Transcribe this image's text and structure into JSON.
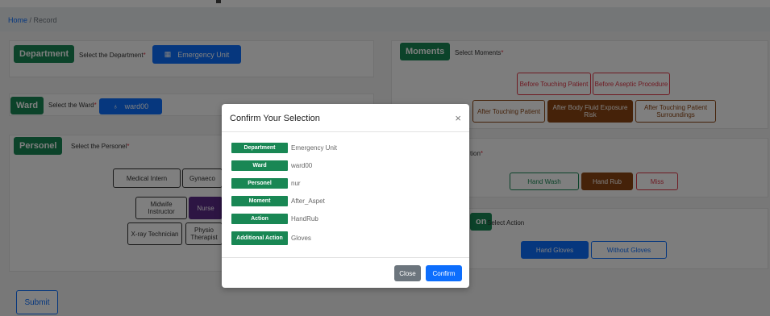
{
  "breadcrumb": {
    "home": "Home",
    "sep": " / ",
    "current": "Record"
  },
  "department": {
    "badge": "Department",
    "prompt": "Select the Department",
    "selected": "Emergency Unit",
    "icon": "building-icon"
  },
  "ward": {
    "badge": "Ward",
    "prompt": "Select the Ward",
    "selected": "ward00",
    "icon": "stethoscope-icon"
  },
  "personel": {
    "badge": "Personel",
    "prompt": "Select the Personel",
    "options": [
      "Medical Intern",
      "Gynaeco",
      "Midwife Instructor",
      "Nurse",
      "X-ray Technician",
      "Physio Therapist"
    ]
  },
  "moments": {
    "badge": "Moments",
    "prompt": "Select Moments",
    "options": [
      "Before Touching Patient",
      "Before Aseptic Procedure",
      "After Touching Patient",
      "After Body Fluid Exposure Risk",
      "After Touching Patient Surroundings"
    ]
  },
  "action": {
    "prompt": "tion",
    "options": [
      "Hand Wash",
      "Hand Rub",
      "Miss"
    ]
  },
  "additional": {
    "badge_tail": "on",
    "prompt": "Select Action",
    "options": [
      "Hand Gloves",
      "Without Gloves"
    ]
  },
  "submit_label": "Submit",
  "modal": {
    "title": "Confirm Your Selection",
    "close_x": "×",
    "rows": [
      {
        "label": "Department",
        "value": "Emergency Unit"
      },
      {
        "label": "Ward",
        "value": "ward00"
      },
      {
        "label": "Personel",
        "value": "nur"
      },
      {
        "label": "Moment",
        "value": "After_Aspet"
      },
      {
        "label": "Action",
        "value": "HandRub"
      },
      {
        "label": "Additional Action",
        "value": "Gloves"
      }
    ],
    "close_label": "Close",
    "confirm_label": "Confirm"
  },
  "colors": {
    "primary": "#0d6efd",
    "success": "#198754",
    "danger": "#dc3545",
    "brown": "#8b4513",
    "secondary": "#6c757d"
  }
}
